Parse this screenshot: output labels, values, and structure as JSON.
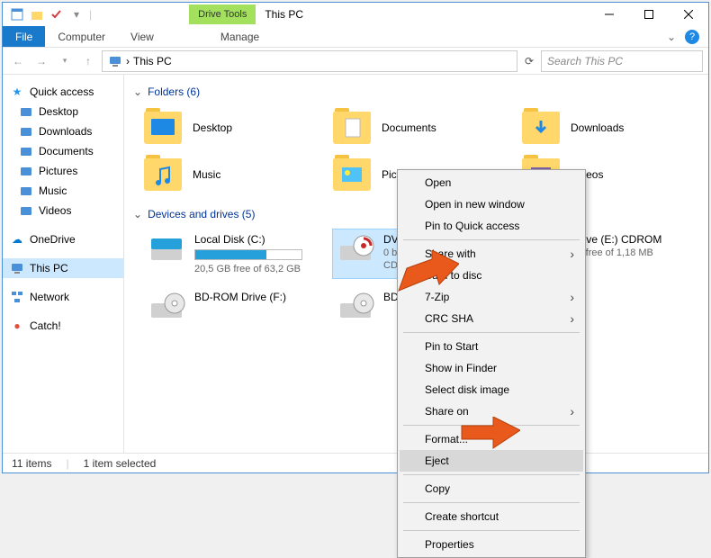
{
  "title": "This PC",
  "drive_tools_label": "Drive Tools",
  "ribbon": {
    "file": "File",
    "computer": "Computer",
    "view": "View",
    "manage": "Manage"
  },
  "breadcrumb": {
    "root": "This PC",
    "chevron": "›"
  },
  "search": {
    "placeholder": "Search This PC"
  },
  "sidebar": {
    "quick_access": "Quick access",
    "items_qa": [
      "Desktop",
      "Downloads",
      "Documents",
      "Pictures",
      "Music",
      "Videos"
    ],
    "onedrive": "OneDrive",
    "this_pc": "This PC",
    "network": "Network",
    "catch": "Catch!"
  },
  "groups": {
    "folders": {
      "label": "Folders (6)",
      "items": [
        "Desktop",
        "Documents",
        "Downloads",
        "Music",
        "Pictures",
        "Videos"
      ]
    },
    "drives": {
      "label": "Devices and drives (5)",
      "items": [
        {
          "name": "Local Disk (C:)",
          "sub": "20,5 GB free of 63,2 GB",
          "fill": 67,
          "type": "hdd",
          "selected": false,
          "has_bar": true
        },
        {
          "name": "DVD Drive (",
          "sub": "0 bytes free",
          "sub2": "CDFS",
          "type": "dvd",
          "selected": true,
          "has_bar": false
        },
        {
          "name": "Drive (E:) CDROM",
          "sub": "es free of 1,18 MB",
          "type": "cd",
          "selected": false,
          "has_bar": false
        },
        {
          "name": "BD-ROM Drive (F:)",
          "sub": "",
          "type": "bd",
          "selected": false,
          "has_bar": false
        },
        {
          "name": "BD-ROM Dr",
          "sub": "",
          "type": "bd",
          "selected": false,
          "has_bar": false
        }
      ]
    }
  },
  "context_menu": {
    "items": [
      {
        "label": "Open",
        "type": "item"
      },
      {
        "label": "Open in new window",
        "type": "item"
      },
      {
        "label": "Pin to Quick access",
        "type": "item"
      },
      {
        "type": "sep"
      },
      {
        "label": "Share with",
        "type": "sub"
      },
      {
        "label": "Burn to disc",
        "type": "item"
      },
      {
        "label": "7-Zip",
        "type": "sub"
      },
      {
        "label": "CRC SHA",
        "type": "sub"
      },
      {
        "type": "sep"
      },
      {
        "label": "Pin to Start",
        "type": "item"
      },
      {
        "label": "Show in Finder",
        "type": "item"
      },
      {
        "label": "Select disk image",
        "type": "item"
      },
      {
        "label": "Share on",
        "type": "sub"
      },
      {
        "type": "sep"
      },
      {
        "label": "Format...",
        "type": "item"
      },
      {
        "label": "Eject",
        "type": "item",
        "hover": true
      },
      {
        "type": "sep"
      },
      {
        "label": "Copy",
        "type": "item"
      },
      {
        "type": "sep"
      },
      {
        "label": "Create shortcut",
        "type": "item"
      },
      {
        "type": "sep"
      },
      {
        "label": "Properties",
        "type": "item"
      }
    ]
  },
  "status": {
    "count": "11 items",
    "selected": "1 item selected"
  }
}
